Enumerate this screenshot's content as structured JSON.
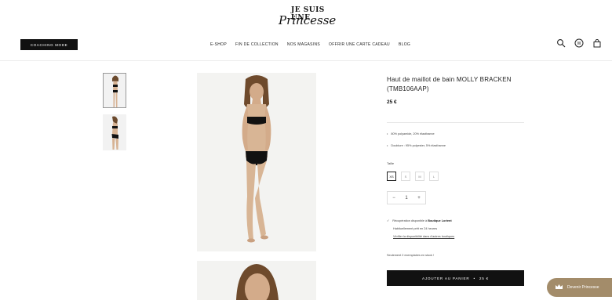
{
  "header": {
    "coaching_button": "COACHING MODE",
    "logo_top": "JE SUIS UNE",
    "logo_script": "Princesse",
    "nav": [
      "E-SHOP",
      "FIN DE COLLECTION",
      "NOS MAGASINS",
      "OFFRIR UNE CARTE CADEAU",
      "BLOG"
    ],
    "icons": [
      "search-icon",
      "account-icon",
      "bag-icon"
    ]
  },
  "product": {
    "title": "Haut de maillot de bain MOLLY BRACKEN (TMB106AAP)",
    "price": "25 €",
    "bullets": [
      "80% polyamide, 20% élasthanne",
      "Doublure : 95% polyester, 5% élasthanne"
    ],
    "size_label": "Taille",
    "sizes": [
      "XS",
      "S",
      "M",
      "L"
    ],
    "selected_size": "XS",
    "quantity": {
      "minus": "−",
      "value": "1",
      "plus": "+"
    },
    "pickup_line1": "Récupération disponible à",
    "pickup_store": "Boutique Lorient",
    "pickup_line2": "Habituellement prêt en 24 heures",
    "pickup_link": "Vérifier la disponibilité dans d'autres boutiques",
    "stock": "Seulement 2 exemplaires en stock !",
    "add_to_cart": "AJOUTER AU PANIER",
    "add_to_cart_price": "25 €"
  },
  "floating_badge": {
    "icon": "crown-icon",
    "label": "Devenir Princesse"
  },
  "colors": {
    "accent": "#111111",
    "badge": "#a38c6a",
    "image_bg": "#f3f3f1"
  }
}
